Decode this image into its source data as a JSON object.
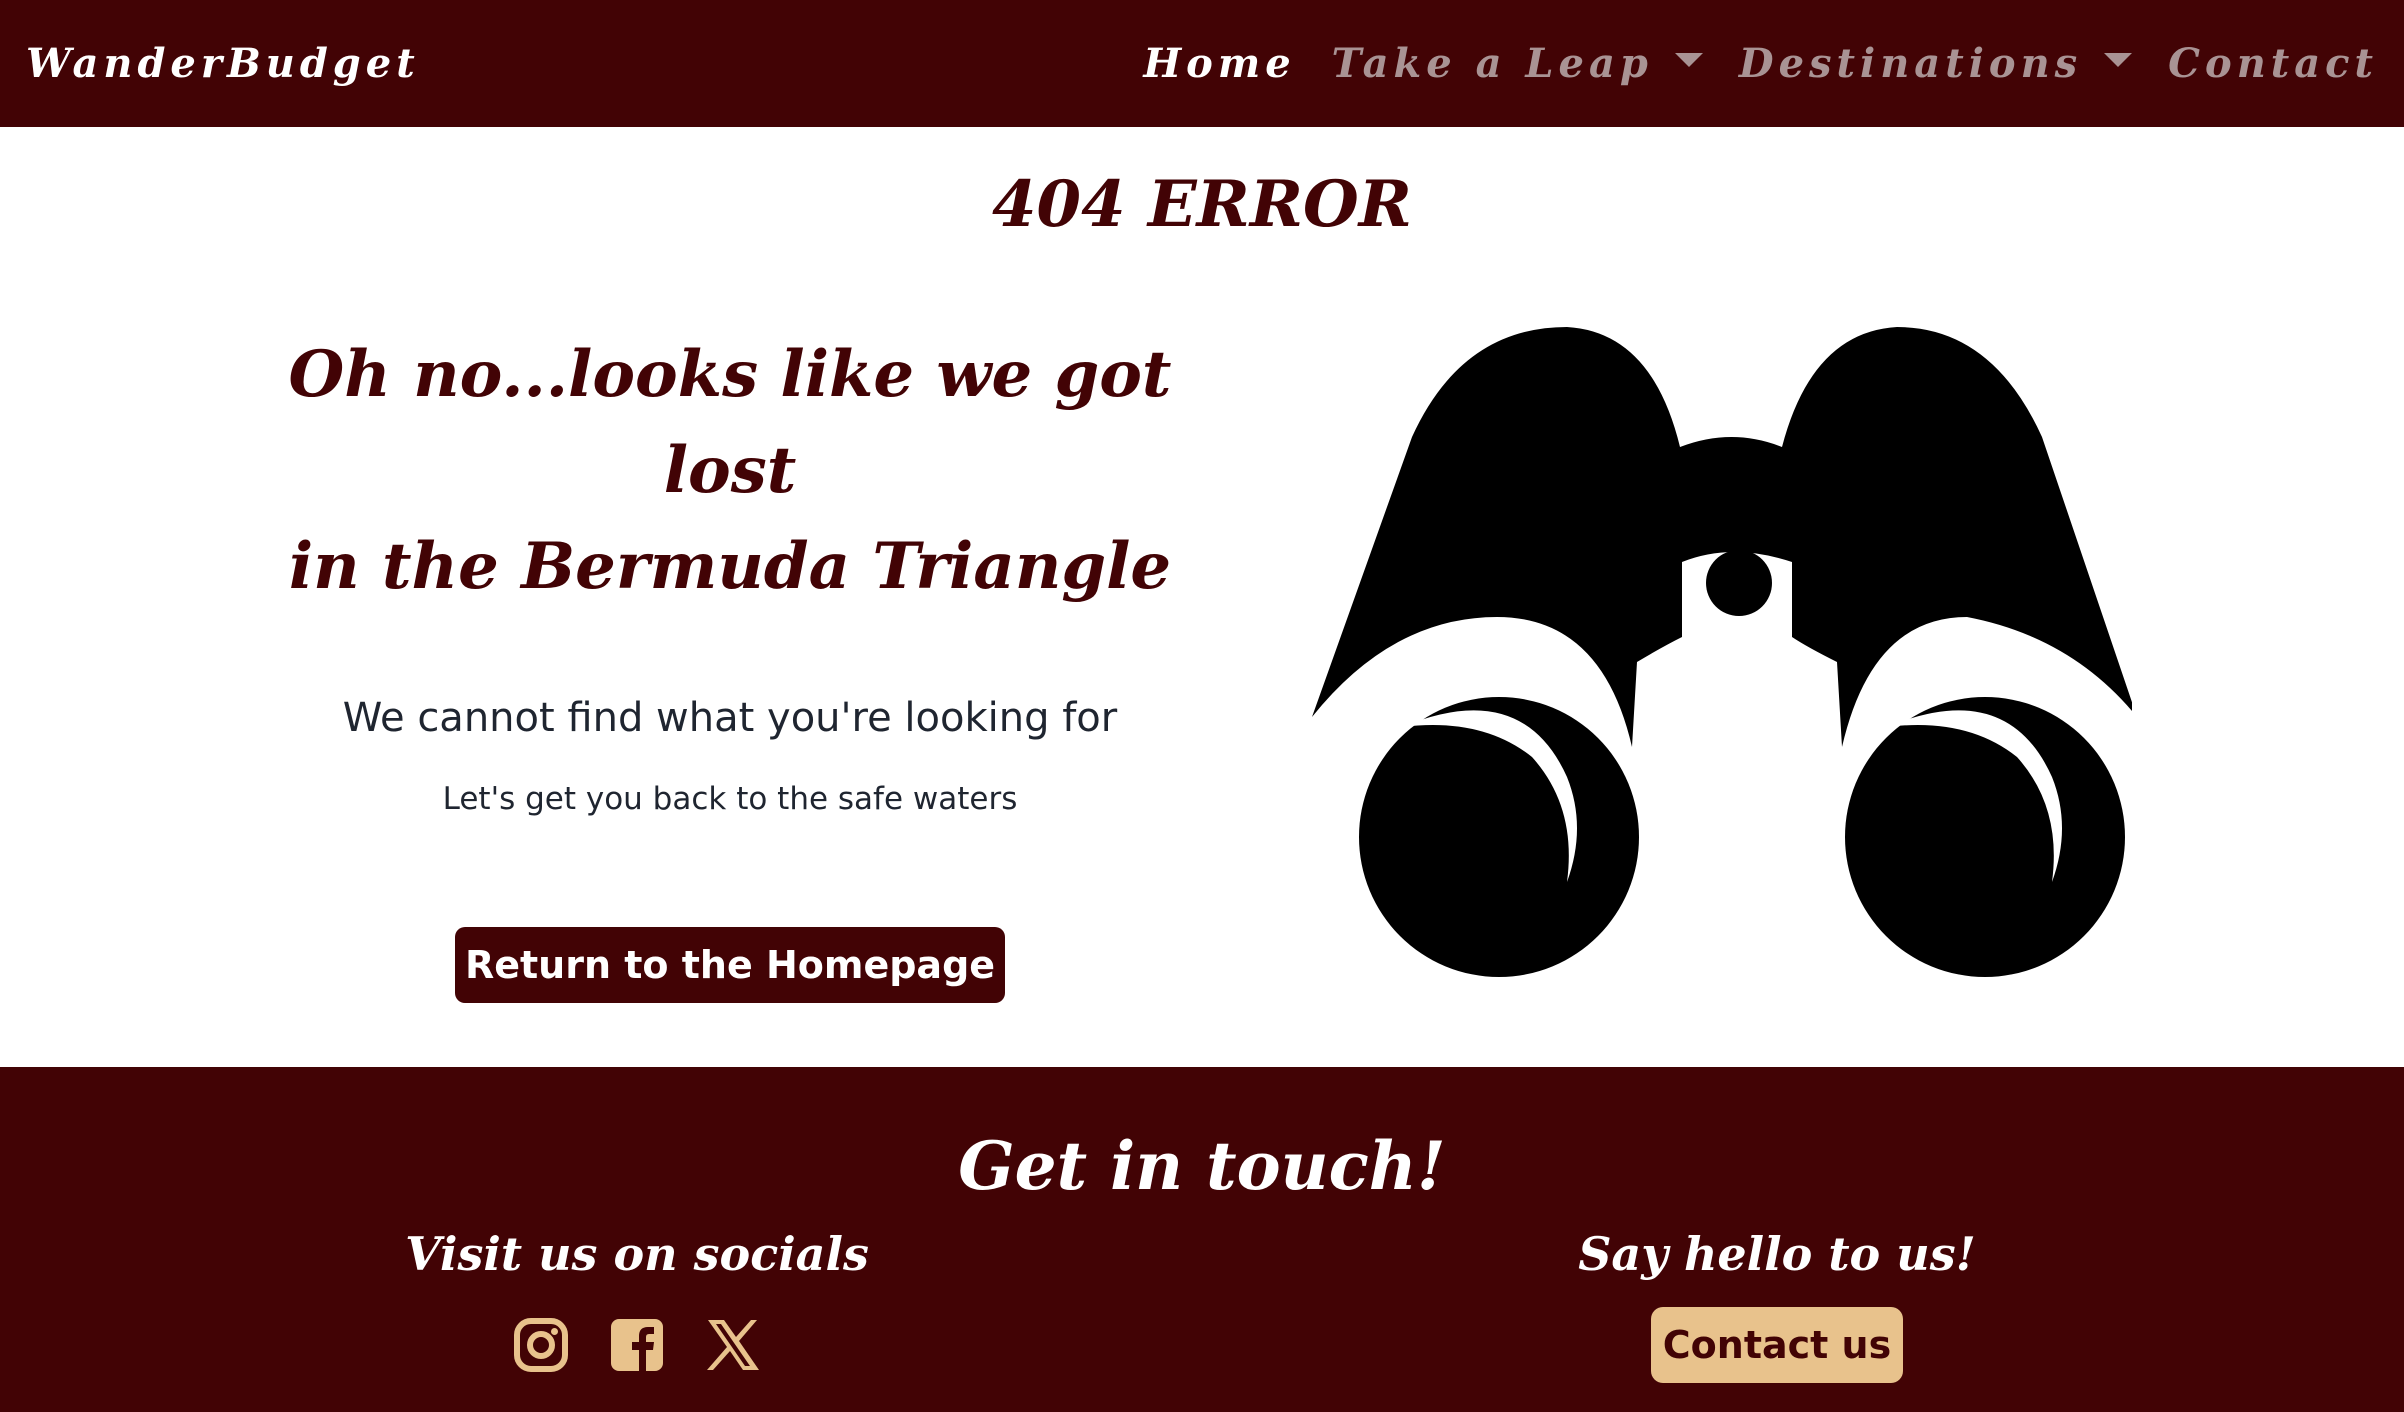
{
  "navbar": {
    "brand": "WanderBudget",
    "links": [
      {
        "label": "Home",
        "active": true,
        "dropdown": false
      },
      {
        "label": "Take a Leap",
        "active": false,
        "dropdown": true
      },
      {
        "label": "Destinations",
        "active": false,
        "dropdown": true
      },
      {
        "label": "Contact",
        "active": false,
        "dropdown": false
      }
    ]
  },
  "main": {
    "error_title": "404 ERROR",
    "headline_line1": "Oh no...looks like we got lost",
    "headline_line2": "in the Bermuda Triangle",
    "subline": "We cannot find what you're looking for",
    "smallline": "Let's get you back to the safe waters",
    "home_button": "Return to the Homepage",
    "illustration": "binoculars-icon"
  },
  "footer": {
    "title": "Get in touch!",
    "socials_heading": "Visit us on socials",
    "socials": [
      "instagram-icon",
      "facebook-icon",
      "x-icon"
    ],
    "hello_heading": "Say hello to us!",
    "contact_button": "Contact us"
  },
  "colors": {
    "brand_dark": "#420305",
    "accent": "#e8c28c",
    "nav_inactive": "#a99394",
    "text_dark": "#1f2530"
  }
}
